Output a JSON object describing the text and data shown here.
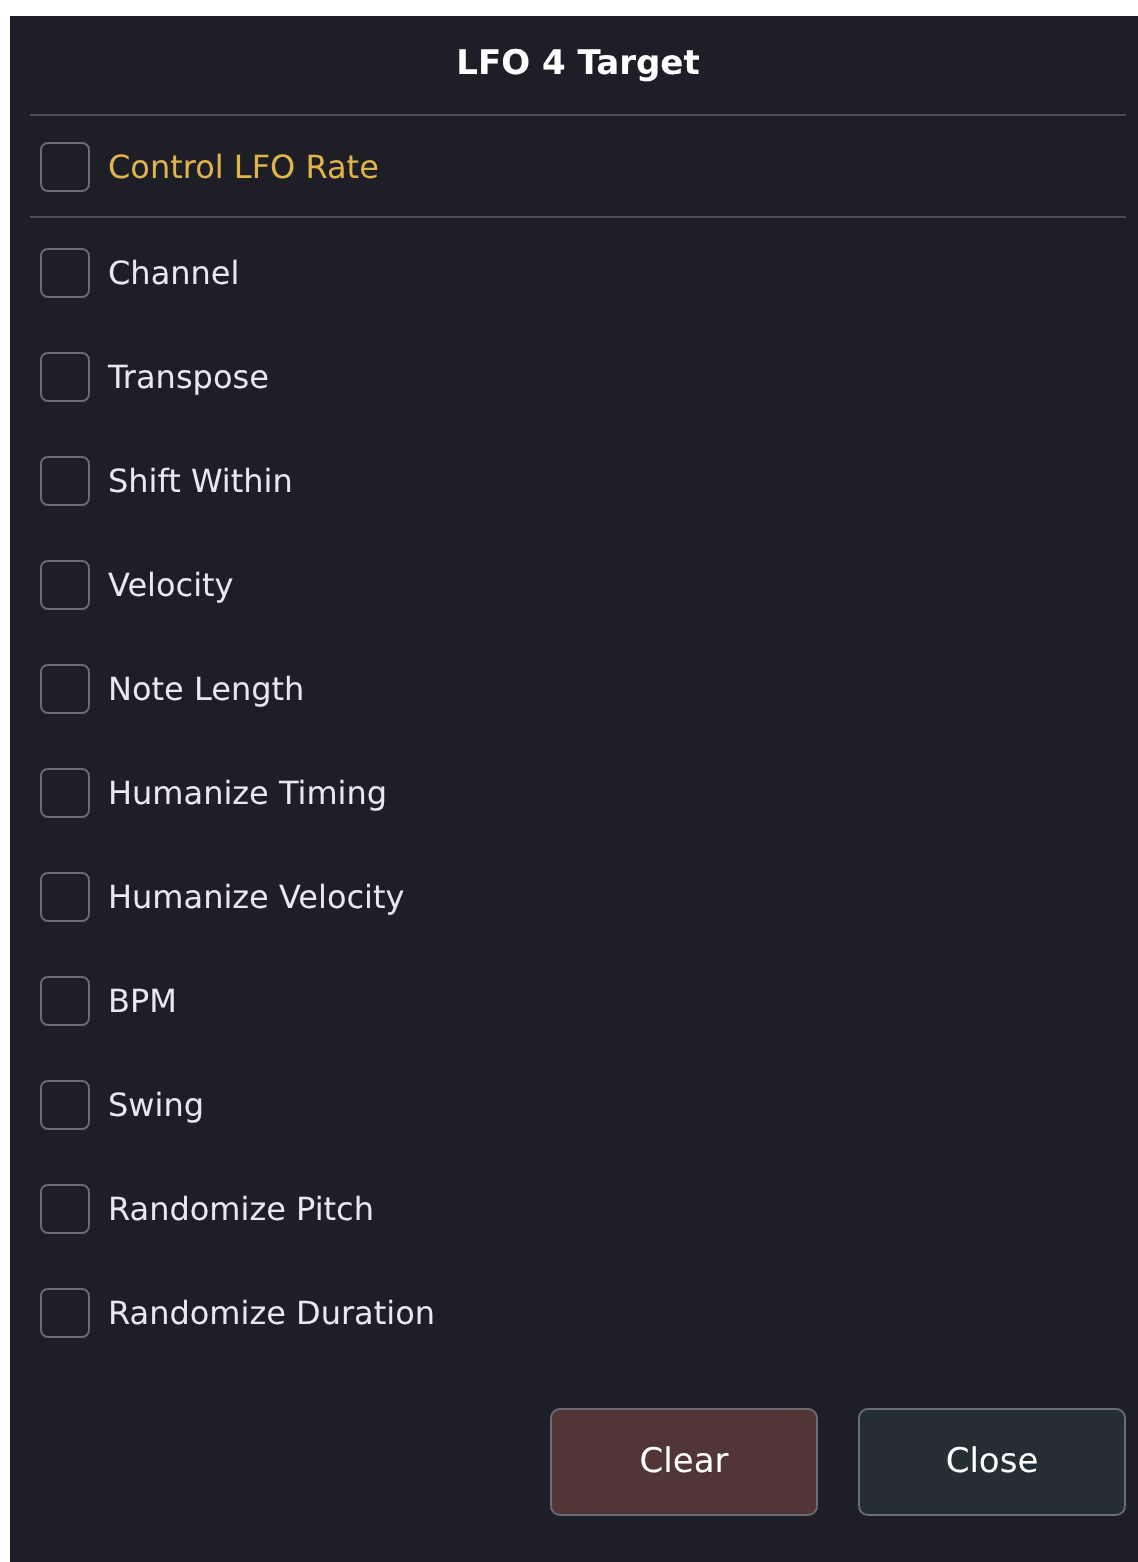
{
  "dialog": {
    "title": "LFO 4 Target"
  },
  "rate_option": {
    "label": "Control LFO Rate",
    "checked": false
  },
  "targets": [
    {
      "label": "Channel",
      "checked": false
    },
    {
      "label": "Transpose",
      "checked": false
    },
    {
      "label": "Shift Within",
      "checked": false
    },
    {
      "label": "Velocity",
      "checked": false
    },
    {
      "label": "Note Length",
      "checked": false
    },
    {
      "label": "Humanize Timing",
      "checked": false
    },
    {
      "label": "Humanize Velocity",
      "checked": false
    },
    {
      "label": "BPM",
      "checked": false
    },
    {
      "label": "Swing",
      "checked": false
    },
    {
      "label": "Randomize Pitch",
      "checked": false
    },
    {
      "label": "Randomize Duration",
      "checked": false
    }
  ],
  "buttons": [
    {
      "label": "Clear",
      "kind": "danger"
    },
    {
      "label": "Close",
      "kind": "neutral"
    }
  ]
}
